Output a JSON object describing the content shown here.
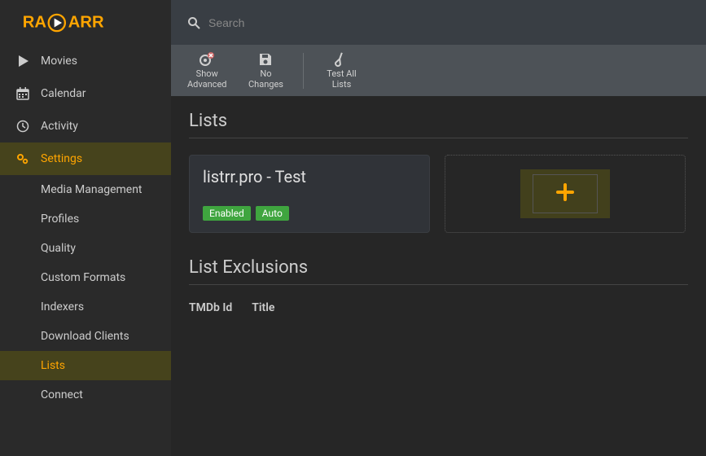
{
  "search": {
    "placeholder": "Search"
  },
  "sidebar": {
    "items": [
      {
        "label": "Movies"
      },
      {
        "label": "Calendar"
      },
      {
        "label": "Activity"
      },
      {
        "label": "Settings"
      }
    ],
    "subitems": [
      {
        "label": "Media Management"
      },
      {
        "label": "Profiles"
      },
      {
        "label": "Quality"
      },
      {
        "label": "Custom Formats"
      },
      {
        "label": "Indexers"
      },
      {
        "label": "Download Clients"
      },
      {
        "label": "Lists"
      },
      {
        "label": "Connect"
      }
    ]
  },
  "toolbar": {
    "advanced_l1": "Show",
    "advanced_l2": "Advanced",
    "changes_l1": "No",
    "changes_l2": "Changes",
    "test_l1": "Test All",
    "test_l2": "Lists"
  },
  "sections": {
    "lists": "Lists",
    "exclusions": "List Exclusions"
  },
  "list_card": {
    "title": "listrr.pro - Test",
    "badge_enabled": "Enabled",
    "badge_auto": "Auto"
  },
  "exclusions_table": {
    "col_tmdb": "TMDb Id",
    "col_title": "Title"
  }
}
